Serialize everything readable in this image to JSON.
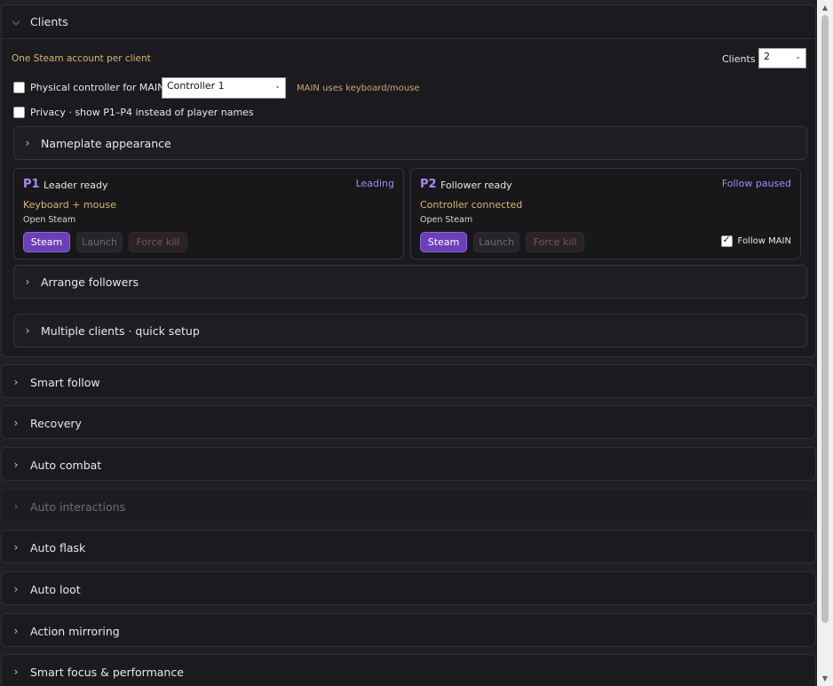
{
  "clients": {
    "title": "Clients",
    "hint": "One Steam account per client",
    "clients_label": "Clients",
    "clients_value": "2",
    "physical_controller_label": "Physical controller for MAIN",
    "controller_value": "Controller 1",
    "main_uses_note": "MAIN uses keyboard/mouse",
    "privacy_label": "Privacy · show P1–P4 instead of player names",
    "nameplate_title": "Nameplate appearance",
    "arrange_title": "Arrange followers",
    "multiple_title": "Multiple clients · quick setup",
    "cards": [
      {
        "pid": "P1",
        "status": "Leader ready",
        "badge": "Leading",
        "input": "Keyboard + mouse",
        "sub": "Open Steam",
        "steam_label": "Steam",
        "launch_label": "Launch",
        "kill_label": "Force kill"
      },
      {
        "pid": "P2",
        "status": "Follower ready",
        "badge": "Follow paused",
        "input": "Controller connected",
        "sub": "Open Steam",
        "steam_label": "Steam",
        "launch_label": "Launch",
        "kill_label": "Force kill",
        "follow_label": "Follow MAIN",
        "follow_checked": true
      }
    ]
  },
  "sections": [
    {
      "title": "Smart follow",
      "enabled": true
    },
    {
      "title": "Recovery",
      "enabled": true
    },
    {
      "title": "Auto combat",
      "enabled": true
    },
    {
      "title": "Auto interactions",
      "enabled": false
    },
    {
      "title": "Auto flask",
      "enabled": true
    },
    {
      "title": "Auto loot",
      "enabled": true
    },
    {
      "title": "Action mirroring",
      "enabled": true
    },
    {
      "title": "Smart focus & performance",
      "enabled": true
    }
  ],
  "colors": {
    "accent": "#6a3fb8",
    "accent_text": "#a888f0",
    "hint": "#d8b574",
    "background": "#202024"
  }
}
